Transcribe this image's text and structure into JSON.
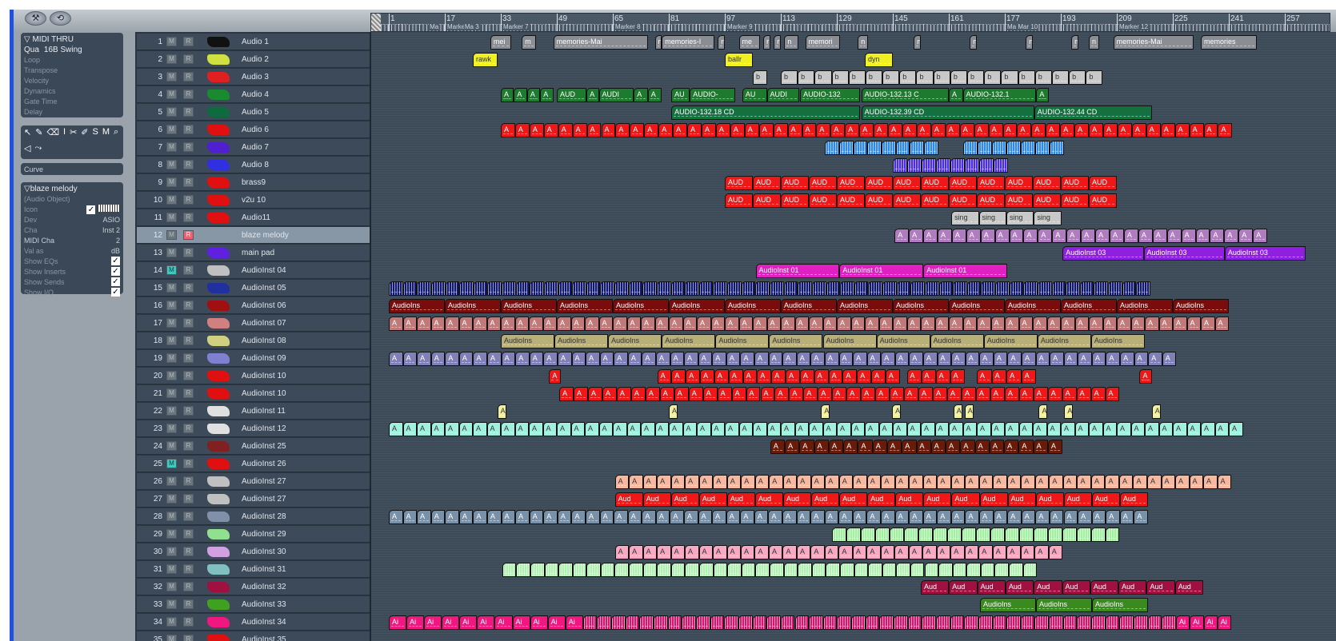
{
  "toolbar": {
    "btn1": "⚒",
    "btn2": "⟲"
  },
  "inspector": {
    "midi": {
      "title": "MIDI THRU",
      "qua_label": "Qua",
      "qua_value": "16B Swing",
      "items": [
        "Loop",
        "Transpose",
        "Velocity",
        "Dynamics",
        "Gate Time",
        "Delay"
      ]
    },
    "tools": [
      "↖",
      "✎",
      "⌫",
      "I",
      "✂",
      "✐",
      "S",
      "M",
      "⌕",
      "◁",
      "⤳"
    ],
    "curve": "Curve",
    "object": {
      "title": "blaze melody",
      "subtitle": "(Audio Object)",
      "icon_label": "Icon",
      "dev_label": "Dev",
      "dev_value": "ASIO",
      "cha_label": "Cha",
      "cha_value": "Inst 2",
      "midi_cha_label": "MIDI Cha",
      "midi_cha_value": "2",
      "val_label": "Val as",
      "val_value": "dB",
      "checks": [
        {
          "label": "Show EQs",
          "checked": true
        },
        {
          "label": "Show Inserts",
          "checked": true
        },
        {
          "label": "Show Sends",
          "checked": true
        },
        {
          "label": "Show I/O",
          "checked": true
        }
      ],
      "check_mark": "✓"
    }
  },
  "button_labels": {
    "mute": "M",
    "rec": "R"
  },
  "ruler": {
    "numbers": [
      "1",
      "17",
      "33",
      "49",
      "65",
      "81",
      "97",
      "113",
      "129",
      "145",
      "161",
      "177",
      "193",
      "209",
      "225",
      "241",
      "257"
    ],
    "markers": [
      {
        "bar": 12,
        "label": "Ma"
      },
      {
        "bar": 17,
        "label": "Marke"
      },
      {
        "bar": 22,
        "label": "Ma 3"
      },
      {
        "bar": 33,
        "label": "Marker 7"
      },
      {
        "bar": 65,
        "label": "Marker 8"
      },
      {
        "bar": 97,
        "label": "Marker 9"
      },
      {
        "bar": 177,
        "label": "Ma Mar 10"
      },
      {
        "bar": 209,
        "label": "Marker 12"
      }
    ]
  },
  "tracks": [
    {
      "num": "1",
      "name": "Audio 1",
      "icon": "speaker-icon",
      "ic": "#111",
      "parts": [
        {
          "from": 30,
          "to": 36,
          "n": 1,
          "label": "mei",
          "color": "#8a8e94"
        },
        {
          "from": 39,
          "to": 43,
          "n": 1,
          "label": "m",
          "color": "#8a8e94"
        },
        {
          "from": 48,
          "to": 75,
          "n": 1,
          "label": "memories-Mai",
          "color": "#8a8e94"
        },
        {
          "from": 77,
          "to": 79,
          "n": 1,
          "label": "n",
          "color": "#8a8e94"
        },
        {
          "from": 79,
          "to": 94,
          "n": 1,
          "label": "memories-I",
          "color": "#8a8e94"
        },
        {
          "from": 95,
          "to": 97,
          "n": 1,
          "label": "n",
          "color": "#8a8e94"
        },
        {
          "from": 101,
          "to": 107,
          "n": 1,
          "label": "me",
          "color": "#8a8e94"
        },
        {
          "from": 108,
          "to": 110,
          "n": 1,
          "label": "r",
          "color": "#8a8e94"
        },
        {
          "from": 111,
          "to": 113,
          "n": 1,
          "label": "r",
          "color": "#8a8e94"
        },
        {
          "from": 114,
          "to": 118,
          "n": 1,
          "label": "n",
          "color": "#8a8e94"
        },
        {
          "from": 120,
          "to": 130,
          "n": 1,
          "label": "memori",
          "color": "#8a8e94"
        },
        {
          "from": 135,
          "to": 138,
          "n": 1,
          "label": "n",
          "color": "#8a8e94"
        },
        {
          "from": 151,
          "to": 153,
          "n": 1,
          "label": "n",
          "color": "#8a8e94"
        },
        {
          "from": 167,
          "to": 169,
          "n": 1,
          "label": "n",
          "color": "#8a8e94"
        },
        {
          "from": 183,
          "to": 185,
          "n": 1,
          "label": "n",
          "color": "#8a8e94"
        },
        {
          "from": 196,
          "to": 198,
          "n": 1,
          "label": "n",
          "color": "#8a8e94"
        },
        {
          "from": 201,
          "to": 204,
          "n": 1,
          "label": "n",
          "color": "#8a8e94"
        },
        {
          "from": 208,
          "to": 231,
          "n": 1,
          "label": "memories-Mai",
          "color": "#8a8e94"
        },
        {
          "from": 233,
          "to": 249,
          "n": 1,
          "label": "memories",
          "color": "#8a8e94"
        }
      ]
    },
    {
      "num": "2",
      "name": "Audio 2",
      "icon": "guitar-icon",
      "ic": "#d0e040",
      "parts": [
        {
          "from": 25,
          "to": 32,
          "n": 1,
          "label": "rawk",
          "color": "#f0f020"
        },
        {
          "from": 97,
          "to": 105,
          "n": 1,
          "label": "ballr",
          "color": "#f0f020"
        },
        {
          "from": 137,
          "to": 145,
          "n": 1,
          "label": "dyn",
          "color": "#f0f020"
        }
      ]
    },
    {
      "num": "3",
      "name": "Audio 3",
      "icon": "horn-icon",
      "ic": "#e02020",
      "parts": [
        {
          "from": 105,
          "to": 109,
          "n": 1,
          "label": "b",
          "color": "#c8c8c8"
        },
        {
          "from": 113,
          "to": 205,
          "n": 19,
          "label": "b",
          "color": "#c8c8c8"
        }
      ]
    },
    {
      "num": "4",
      "name": "Audio 4",
      "icon": "synth-icon",
      "ic": "#1a8a30",
      "parts": [
        {
          "from": 33,
          "to": 48,
          "n": 4,
          "label": "A",
          "color": "#1e7a2e"
        },
        {
          "from": 49,
          "to": 57.5,
          "n": 1,
          "label": "AUD",
          "color": "#1e7a2e"
        },
        {
          "from": 57.5,
          "to": 61,
          "n": 1,
          "label": "A",
          "color": "#1e7a2e"
        },
        {
          "from": 61,
          "to": 71,
          "n": 1,
          "label": "AUDI",
          "color": "#1e7a2e"
        },
        {
          "from": 71,
          "to": 79,
          "n": 2,
          "label": "A",
          "color": "#1e7a2e"
        },
        {
          "from": 81.7,
          "to": 87,
          "n": 1,
          "label": "AU",
          "color": "#1e7a2e"
        },
        {
          "from": 87,
          "to": 100,
          "n": 1,
          "label": "AUDIO-",
          "color": "#1e7a2e"
        },
        {
          "from": 102,
          "to": 109,
          "n": 1,
          "label": "AU",
          "color": "#1e7a2e"
        },
        {
          "from": 109,
          "to": 118.3,
          "n": 1,
          "label": "AUDI",
          "color": "#1e7a2e"
        },
        {
          "from": 118.5,
          "to": 135.6,
          "n": 1,
          "label": "AUDIO-132",
          "color": "#1e7a2e"
        },
        {
          "from": 136,
          "to": 161,
          "n": 1,
          "label": "AUDIO-132.13 C",
          "color": "#1e7a2e"
        },
        {
          "from": 161,
          "to": 165,
          "n": 1,
          "label": "A",
          "color": "#1e7a2e"
        },
        {
          "from": 165,
          "to": 186,
          "n": 1,
          "label": "AUDIO-132.1",
          "color": "#1e7a2e"
        },
        {
          "from": 186,
          "to": 189.6,
          "n": 1,
          "label": "A",
          "color": "#1e7a2e"
        }
      ]
    },
    {
      "num": "5",
      "name": "Audio 5",
      "icon": "keyboard-icon",
      "ic": "#106a40",
      "parts": [
        {
          "from": 81.7,
          "to": 135.6,
          "n": 1,
          "label": "AUDIO-132.18  CD",
          "color": "#157040"
        },
        {
          "from": 136,
          "to": 185.4,
          "n": 1,
          "label": "AUDIO-132.39  CD",
          "color": "#157040"
        },
        {
          "from": 185.4,
          "to": 219,
          "n": 1,
          "label": "AUDIO-132.44  CD",
          "color": "#157040"
        }
      ]
    },
    {
      "num": "6",
      "name": "Audio 6",
      "icon": "trumpet-icon",
      "ic": "#e01010",
      "parts": [
        {
          "from": 33,
          "to": 242,
          "n": 51,
          "label": "A",
          "color": "#ee1818"
        }
      ]
    },
    {
      "num": "7",
      "name": "Audio 7",
      "icon": "wing-icon",
      "ic": "#5020d0",
      "parts": [
        {
          "from": 125.6,
          "to": 158,
          "n": 8,
          "label": "",
          "color": "#2e8ae6",
          "stripe": true
        },
        {
          "from": 165,
          "to": 194,
          "n": 7,
          "label": "",
          "color": "#2e8ae6",
          "stripe": true
        }
      ]
    },
    {
      "num": "8",
      "name": "Audio 8",
      "icon": "wing-icon",
      "ic": "#3030e0",
      "parts": [
        {
          "from": 145,
          "to": 178,
          "n": 8,
          "label": "",
          "color": "#4a2ee0",
          "stripe": true
        }
      ]
    },
    {
      "num": "9",
      "name": "brass9",
      "icon": "brass-icon",
      "ic": "#e01010",
      "parts": [
        {
          "from": 97,
          "to": 209,
          "n": 14,
          "label": "AUD",
          "color": "#ee1818"
        }
      ]
    },
    {
      "num": "10",
      "name": "v2u 10",
      "icon": "synth-icon",
      "ic": "#e01010",
      "parts": [
        {
          "from": 97,
          "to": 209,
          "n": 14,
          "label": "AUD",
          "color": "#ee1818"
        }
      ]
    },
    {
      "num": "11",
      "name": "Audio11",
      "icon": "synth-icon",
      "ic": "#e01010",
      "parts": [
        {
          "from": 161.7,
          "to": 193.2,
          "n": 4,
          "label": "sing",
          "color": "#c8c8c8"
        }
      ]
    },
    {
      "num": "12",
      "name": "blaze melody",
      "icon": "blank-icon",
      "ic": "transparent",
      "sel": true,
      "rec": true,
      "parts": [
        {
          "from": 145.5,
          "to": 252,
          "n": 26,
          "label": "A",
          "color": "#b07cc0"
        }
      ]
    },
    {
      "num": "13",
      "name": "main pad",
      "icon": "pad-icon",
      "ic": "#6020e0",
      "parts": [
        {
          "from": 193.5,
          "to": 263,
          "n": 3,
          "label": "AudioInst 03",
          "color": "#9020e0"
        }
      ]
    },
    {
      "num": "14",
      "name": "AudioInst 04",
      "icon": "drum-icon",
      "ic": "#c0c0c0",
      "mute": true,
      "parts": [
        {
          "from": 105.8,
          "to": 177.7,
          "n": 3,
          "label": "AudioInst 01",
          "color": "#e020c0"
        }
      ]
    },
    {
      "num": "15",
      "name": "AudioInst 05",
      "icon": "eye-icon",
      "ic": "#2030a0",
      "parts": [
        {
          "from": 1,
          "to": 218.6,
          "n": 54,
          "label": "",
          "color": "#101870",
          "stripe": true
        }
      ]
    },
    {
      "num": "16",
      "name": "AudioInst 06",
      "icon": "organ-icon",
      "ic": "#a01010",
      "parts": [
        {
          "from": 1,
          "to": 241,
          "n": 15,
          "label": "AudioIns",
          "color": "#7a0c0c"
        }
      ]
    },
    {
      "num": "17",
      "name": "AudioInst 07",
      "icon": "cross-icon",
      "ic": "#d08080",
      "parts": [
        {
          "from": 1,
          "to": 241,
          "n": 60,
          "label": "A",
          "color": "#c07878"
        }
      ]
    },
    {
      "num": "18",
      "name": "AudioInst 08",
      "icon": "key-icon",
      "ic": "#d0d080",
      "parts": [
        {
          "from": 33,
          "to": 217,
          "n": 12,
          "label": "AudioIns",
          "color": "#b8b078"
        }
      ]
    },
    {
      "num": "19",
      "name": "AudioInst 09",
      "icon": "bell-icon",
      "ic": "#8080d0",
      "parts": [
        {
          "from": 1,
          "to": 226,
          "n": 56,
          "label": "A",
          "color": "#8080b8"
        }
      ]
    },
    {
      "num": "20",
      "name": "AudioInst 10",
      "icon": "synth-icon",
      "ic": "#e01010",
      "parts": [
        {
          "from": 46.8,
          "to": 50.2,
          "n": 1,
          "label": "A",
          "color": "#ee1818"
        },
        {
          "from": 77.7,
          "to": 147,
          "n": 17,
          "label": "A",
          "color": "#ee1818"
        },
        {
          "from": 149,
          "to": 165.5,
          "n": 4,
          "label": "A",
          "color": "#ee1818"
        },
        {
          "from": 169,
          "to": 186,
          "n": 4,
          "label": "A",
          "color": "#ee1818"
        },
        {
          "from": 215.5,
          "to": 219,
          "n": 1,
          "label": "A",
          "color": "#ee1818"
        }
      ]
    },
    {
      "num": "21",
      "name": "AudioInst 10",
      "icon": "synth-icon",
      "ic": "#e01010",
      "parts": [
        {
          "from": 49.7,
          "to": 209.8,
          "n": 39,
          "label": "A",
          "color": "#ee1818"
        }
      ]
    },
    {
      "num": "22",
      "name": "AudioInst 11",
      "icon": "guitar-icon",
      "ic": "#e0e0e0",
      "parts": [
        {
          "from": 32,
          "to": 34.5,
          "n": 1,
          "label": "A",
          "color": "#f0f0a0"
        },
        {
          "from": 81,
          "to": 83.5,
          "n": 1,
          "label": "A",
          "color": "#f0f0a0"
        },
        {
          "from": 124.5,
          "to": 127,
          "n": 1,
          "label": "A",
          "color": "#f0f0a0"
        },
        {
          "from": 144.8,
          "to": 147.3,
          "n": 1,
          "label": "A",
          "color": "#f0f0a0"
        },
        {
          "from": 162.3,
          "to": 164.8,
          "n": 1,
          "label": "A",
          "color": "#f0f0a0"
        },
        {
          "from": 165.5,
          "to": 168,
          "n": 1,
          "label": "A",
          "color": "#f0f0a0"
        },
        {
          "from": 186.7,
          "to": 189.2,
          "n": 1,
          "label": "A",
          "color": "#f0f0a0"
        },
        {
          "from": 194,
          "to": 196.5,
          "n": 1,
          "label": "A",
          "color": "#f0f0a0"
        },
        {
          "from": 219,
          "to": 221.5,
          "n": 1,
          "label": "A",
          "color": "#f0f0a0"
        }
      ]
    },
    {
      "num": "23",
      "name": "AudioInst 12",
      "icon": "notes-icon",
      "ic": "#e0e0e0",
      "parts": [
        {
          "from": 1,
          "to": 245,
          "n": 61,
          "label": "A",
          "color": "#a0f0e0"
        }
      ]
    },
    {
      "num": "24",
      "name": "AudioInst 25",
      "icon": "arrow-icon",
      "ic": "#802020",
      "parts": [
        {
          "from": 110,
          "to": 193.5,
          "n": 20,
          "label": "A",
          "color": "#6a1a08"
        }
      ]
    },
    {
      "num": "25",
      "name": "AudioInst 26",
      "icon": "synth-icon",
      "ic": "#e01010",
      "mute": true,
      "parts": []
    },
    {
      "num": "26",
      "name": "AudioInst 27",
      "icon": "choir-icon",
      "ic": "#c0c0c0",
      "parts": [
        {
          "from": 65.6,
          "to": 241.7,
          "n": 44,
          "label": "A",
          "color": "#f8b8a0"
        }
      ]
    },
    {
      "num": "27",
      "name": "AudioInst 27",
      "icon": "choir-icon",
      "ic": "#c0c0c0",
      "parts": [
        {
          "from": 65.6,
          "to": 217.9,
          "n": 19,
          "label": "Aud",
          "color": "#ee1818"
        }
      ]
    },
    {
      "num": "28",
      "name": "AudioInst 28",
      "icon": "cloud-icon",
      "ic": "#8090a8",
      "parts": [
        {
          "from": 1,
          "to": 217.9,
          "n": 54,
          "label": "A",
          "color": "#7890a8"
        }
      ]
    },
    {
      "num": "29",
      "name": "AudioInst 29",
      "icon": "tree-icon",
      "ic": "#90e090",
      "parts": [
        {
          "from": 127.7,
          "to": 209.8,
          "n": 20,
          "label": "",
          "color": "#a0f0a0",
          "stripe": true
        }
      ]
    },
    {
      "num": "30",
      "name": "AudioInst 30",
      "icon": "guitar-icon",
      "ic": "#d0a0e0",
      "parts": [
        {
          "from": 65.6,
          "to": 193.5,
          "n": 32,
          "label": "A",
          "color": "#f8a8c0"
        }
      ]
    },
    {
      "num": "31",
      "name": "AudioInst 31",
      "icon": "lamp-icon",
      "ic": "#80c0c0",
      "parts": [
        {
          "from": 33.4,
          "to": 186.2,
          "n": 38,
          "label": "",
          "color": "#b0f0b0",
          "stripe": true
        }
      ]
    },
    {
      "num": "32",
      "name": "AudioInst 32",
      "icon": "violin-icon",
      "ic": "#a01040",
      "parts": [
        {
          "from": 153,
          "to": 233.7,
          "n": 10,
          "label": "Aud",
          "color": "#a01040"
        }
      ]
    },
    {
      "num": "33",
      "name": "AudioInst 33",
      "icon": "vl-icon",
      "ic": "#40a020",
      "parts": [
        {
          "from": 169.9,
          "to": 217.9,
          "n": 3,
          "label": "AudioIns",
          "color": "#3a8a20"
        }
      ]
    },
    {
      "num": "34",
      "name": "AudioInst 34",
      "icon": "key-icon",
      "ic": "#f01880",
      "parts": [
        {
          "from": 1,
          "to": 56.5,
          "n": 11,
          "label": "Ai",
          "color": "#f01880"
        },
        {
          "from": 56.5,
          "to": 225.9,
          "n": 42,
          "label": "",
          "color": "#d01870",
          "stripe": true
        },
        {
          "from": 225.9,
          "to": 241.7,
          "n": 4,
          "label": "Ai",
          "color": "#f01880"
        }
      ]
    },
    {
      "num": "35",
      "name": "AudioInst 35",
      "icon": "synth-icon",
      "ic": "#e01010",
      "parts": []
    }
  ]
}
